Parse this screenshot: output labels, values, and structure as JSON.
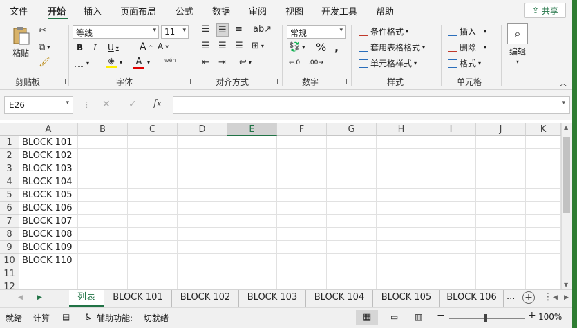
{
  "menu": {
    "items": [
      "文件",
      "开始",
      "插入",
      "页面布局",
      "公式",
      "数据",
      "审阅",
      "视图",
      "开发工具",
      "帮助"
    ],
    "share_label": "共享"
  },
  "ribbon": {
    "clipboard": {
      "paste_label": "粘贴",
      "group_label": "剪贴板"
    },
    "font": {
      "font_name": "等线",
      "font_size": "11",
      "group_label": "字体",
      "phonetic_label": "wén"
    },
    "alignment": {
      "group_label": "对齐方式"
    },
    "number": {
      "format": "常规",
      "group_label": "数字"
    },
    "styles": {
      "conditional_label": "条件格式",
      "table_label": "套用表格格式",
      "cell_styles_label": "单元格样式",
      "group_label": "样式"
    },
    "cells": {
      "insert_label": "插入",
      "delete_label": "删除",
      "format_label": "格式",
      "group_label": "单元格"
    },
    "editing": {
      "label": "编辑"
    }
  },
  "formula_bar": {
    "name_box": "E26",
    "fx": "fx",
    "formula": ""
  },
  "grid": {
    "columns": [
      "A",
      "B",
      "C",
      "D",
      "E",
      "F",
      "G",
      "H",
      "I",
      "J",
      "K"
    ],
    "selected_column": "E",
    "rows": [
      "1",
      "2",
      "3",
      "4",
      "5",
      "6",
      "7",
      "8",
      "9",
      "10",
      "11",
      "12"
    ],
    "cells_a": [
      "BLOCK 101",
      "BLOCK 102",
      "BLOCK 103",
      "BLOCK 104",
      "BLOCK 105",
      "BLOCK 106",
      "BLOCK 107",
      "BLOCK 108",
      "BLOCK 109",
      "BLOCK 110"
    ]
  },
  "sheet_tabs": {
    "tabs": [
      "列表",
      "BLOCK 101",
      "BLOCK 102",
      "BLOCK 103",
      "BLOCK 104",
      "BLOCK 105",
      "BLOCK 106"
    ],
    "active": "列表",
    "more": "..."
  },
  "status_bar": {
    "ready": "就绪",
    "calc": "计算",
    "accessibility": "辅助功能: 一切就绪",
    "zoom": "100%"
  },
  "colors": {
    "accent": "#217346",
    "font_color_red": "#e00000",
    "highlight_yellow": "#ffee00"
  }
}
